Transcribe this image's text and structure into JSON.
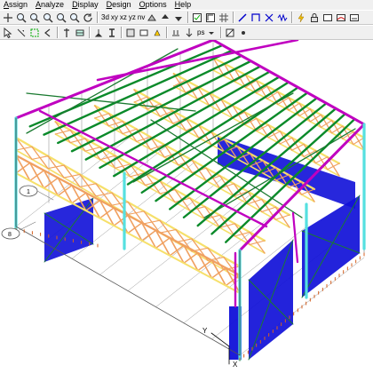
{
  "menu": {
    "items": [
      {
        "label_rest": "ssign",
        "first": "A"
      },
      {
        "label_rest": "nalyze",
        "first": "A"
      },
      {
        "label_rest": "isplay",
        "first": "D"
      },
      {
        "label_rest": "esign",
        "first": "D"
      },
      {
        "label_rest": "ptions",
        "first": "O"
      },
      {
        "label_rest": "elp",
        "first": "H"
      }
    ]
  },
  "toolbar": {
    "view_3d_label": "3d",
    "view_xy_label": "xy",
    "view_xz_label": "xz",
    "view_yz_label": "yz",
    "nv_label": "nv",
    "ps_label": "ps"
  },
  "viewport": {
    "grid_bubble_1": "1",
    "grid_bubble_2": "8",
    "axis_x_label": "X",
    "axis_y_label": "Y",
    "colors": {
      "column": "#55e0e0",
      "girder": "#c000c0",
      "purlin": "#0a8a2a",
      "truss": "#f0a060",
      "chord": "#f6e06a",
      "bracing": "#1a7a30",
      "wall_panel": "#1010d8",
      "gridline": "#9a9a9a",
      "support": "#d46020"
    }
  }
}
